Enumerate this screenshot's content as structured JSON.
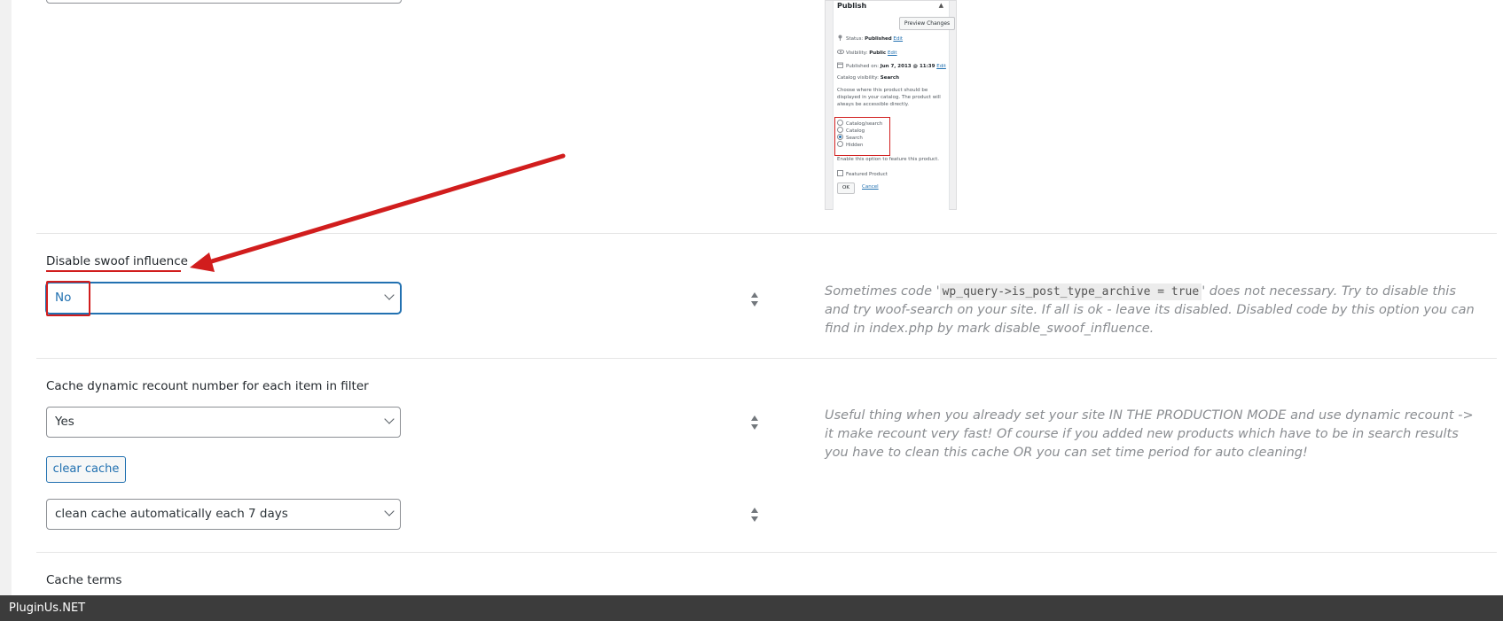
{
  "thumbnail": {
    "title": "Publish",
    "preview_button": "Preview Changes",
    "status_label": "Status:",
    "status_value": "Published",
    "status_edit": "Edit",
    "visibility_label": "Visibility:",
    "visibility_value": "Public",
    "visibility_edit": "Edit",
    "published_label": "Published on:",
    "published_value": "Jun 7, 2013 @ 11:39",
    "published_edit": "Edit",
    "catalog_label": "Catalog visibility:",
    "catalog_value": "Search",
    "choose_text_1": "Choose where this product should be",
    "choose_text_2": "displayed in your catalog. The product will",
    "choose_text_3": "always be accessible directly.",
    "radio_options": [
      "Catalog/search",
      "Catalog",
      "Search",
      "Hidden"
    ],
    "radio_selected_index": 2,
    "feature_hint": "Enable this option to feature this product.",
    "featured_label": "Featured Product",
    "ok_label": "OK",
    "cancel_label": "Cancel"
  },
  "options": {
    "disable_swoof": {
      "title": "Disable swoof influence",
      "selected": "No",
      "desc_before": "Sometimes code '",
      "desc_code": "wp_query->is_post_type_archive = true",
      "desc_after": "' does not necessary. Try to disable this and try woof-search on your site. If all is ok - leave its disabled. Disabled code by this option you can find in index.php by mark disable_swoof_influence."
    },
    "cache_recount": {
      "title": "Cache dynamic recount number for each item in filter",
      "selected": "Yes",
      "clear_button": "clear cache",
      "period_selected": "clean cache automatically each 7 days",
      "desc": "Useful thing when you already set your site IN THE PRODUCTION MODE and use dynamic recount -> it make recount very fast! Of course if you added new products which have to be in search results you have to clean this cache OR you can set time period for auto cleaning!"
    },
    "cache_terms": {
      "title": "Cache terms"
    }
  },
  "footer": {
    "brand": "PluginUs.NET"
  },
  "colors": {
    "annotation_red": "#d11d1d",
    "link_blue": "#2271b1",
    "footer_bg": "#3c3c3c"
  }
}
